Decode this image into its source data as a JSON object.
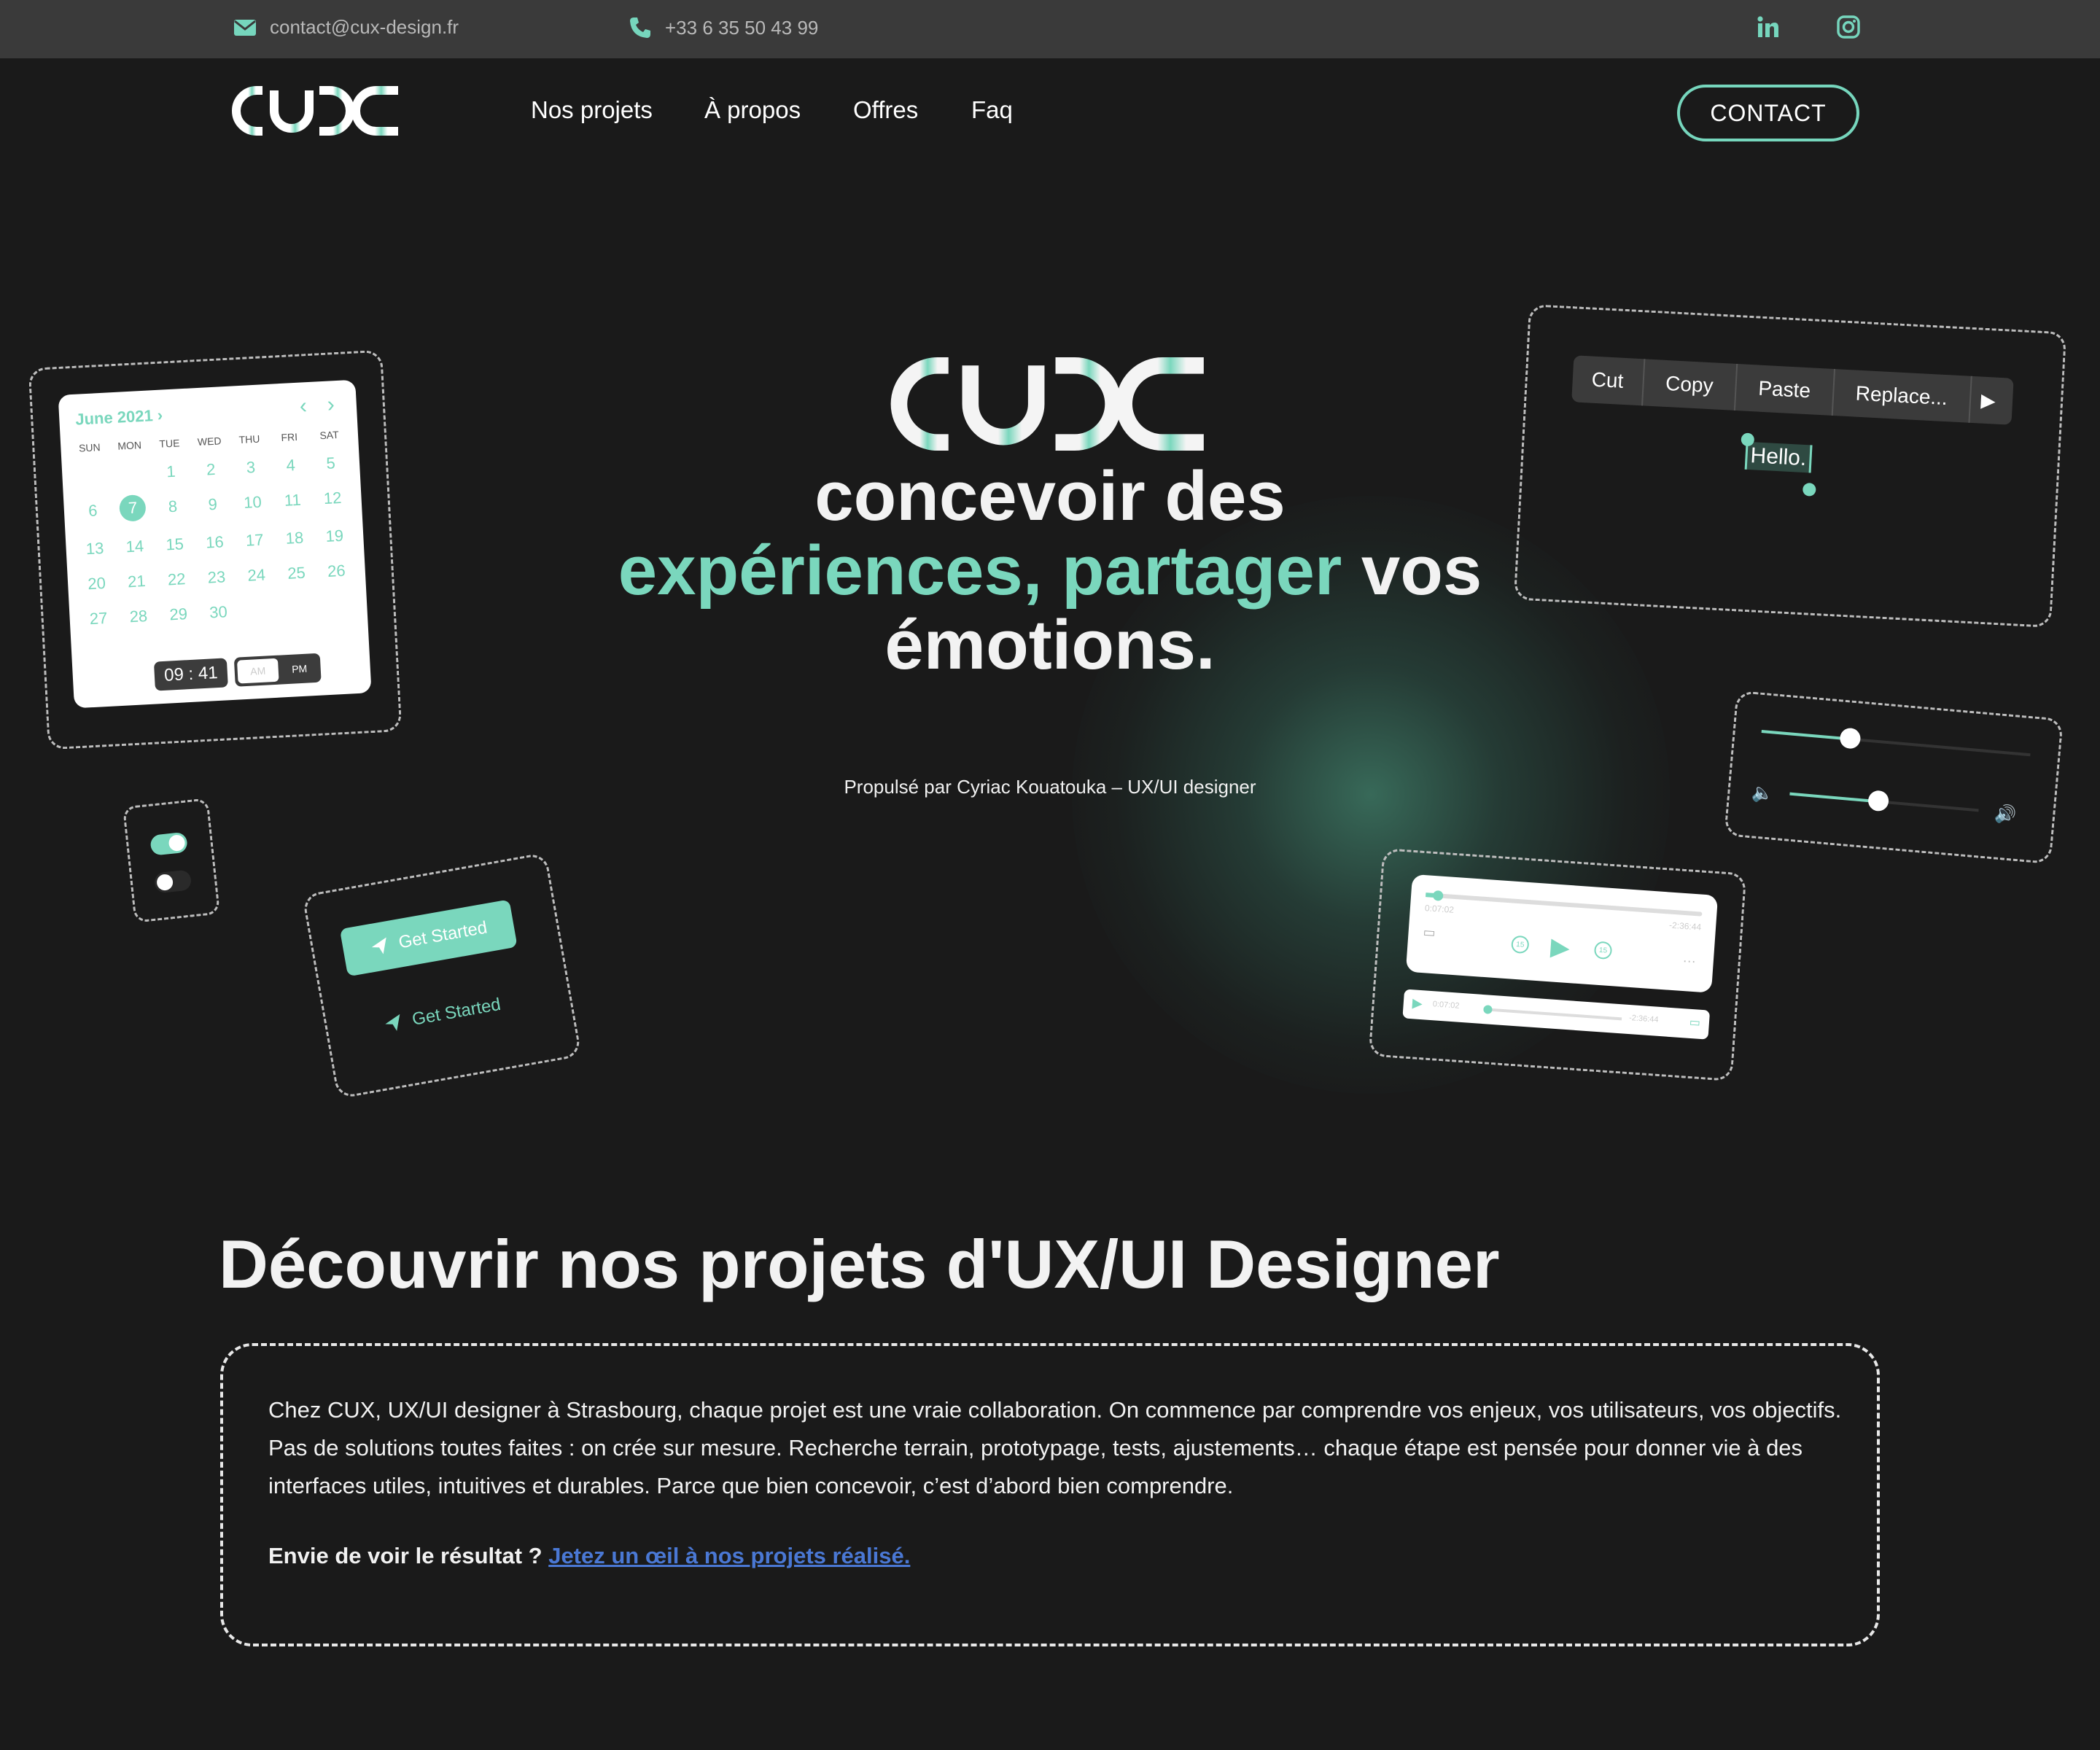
{
  "topbar": {
    "email": "contact@cux-design.fr",
    "phone": "+33 6 35 50 43 99",
    "social": [
      "linkedin-icon",
      "instagram-icon"
    ]
  },
  "nav": {
    "logo_text": "CUX",
    "links": [
      "Nos projets",
      "À propos",
      "Offres",
      "Faq"
    ],
    "contact_label": "CONTACT"
  },
  "hero": {
    "logo_text": "CUX",
    "title_line1": "concevoir des",
    "title_accent1": "expériences,",
    "title_accent2": "partager",
    "title_rest": "vos",
    "title_line3": "émotions.",
    "subtitle": "Propulsé par Cyriac Kouatouka – UX/UI designer"
  },
  "calendar_card": {
    "month": "June 2021",
    "days": [
      "SUN",
      "MON",
      "TUE",
      "WED",
      "THU",
      "FRI",
      "SAT"
    ],
    "dates": [
      "",
      "",
      "1",
      "2",
      "3",
      "4",
      "5",
      "6",
      "7",
      "8",
      "9",
      "10",
      "11",
      "12",
      "13",
      "14",
      "15",
      "16",
      "17",
      "18",
      "19",
      "20",
      "21",
      "22",
      "23",
      "24",
      "25",
      "26",
      "27",
      "28",
      "29",
      "30"
    ],
    "selected": "7",
    "time": "09 : 41",
    "am": "AM",
    "pm": "PM"
  },
  "context_menu_card": {
    "items": [
      "Cut",
      "Copy",
      "Paste",
      "Replace..."
    ],
    "selected_text": "Hello."
  },
  "buttons_card": {
    "filled_label": "Get Started",
    "text_label": "Get Started"
  },
  "player_card": {
    "elapsed": "0:07:02",
    "remaining": "-2:36:44",
    "skip_back": "15",
    "skip_forward": "15"
  },
  "colors": {
    "accent": "#7ad7bd",
    "background": "#1a1a1a",
    "topbar": "#3a3a3a",
    "link": "#4a78d4"
  },
  "section": {
    "title": "Découvrir nos projets d'UX/UI Designer",
    "paragraph": "Chez CUX, UX/UI designer à Strasbourg, chaque projet est une vraie collaboration. On commence par comprendre vos enjeux, vos utilisateurs, vos objectifs. Pas de solutions toutes faites : on crée sur mesure. Recherche terrain, prototypage, tests, ajustements… chaque étape est pensée pour donner vie à des interfaces utiles, intuitives et durables. Parce que bien concevoir, c’est d’abord bien comprendre.",
    "cta_prefix": "Envie de voir le résultat ?",
    "cta_link": "Jetez un œil à nos projets réalisé."
  }
}
